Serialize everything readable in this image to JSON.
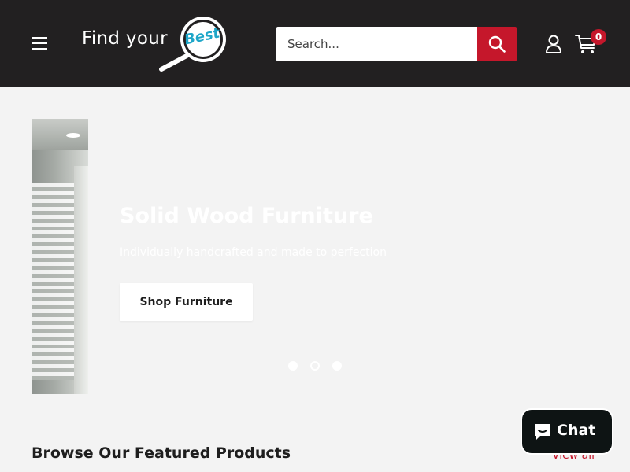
{
  "header": {
    "logo": {
      "text": "Find your",
      "highlight": "Best"
    },
    "search": {
      "placeholder": "Search..."
    },
    "cart": {
      "count": "0"
    },
    "icons": {
      "menu": "hamburger-menu-icon",
      "search": "search-icon",
      "account": "user-icon",
      "cart": "cart-icon"
    }
  },
  "hero": {
    "title": "Solid Wood Furniture",
    "subtitle": "Individually handcrafted and made to perfection",
    "cta_label": "Shop Furniture",
    "slides": 3,
    "active_slide": 1
  },
  "featured": {
    "title": "Browse Our Featured Products",
    "view_all": "View all"
  },
  "chat": {
    "label": "Chat",
    "icon": "chat-bubble-icon"
  },
  "colors": {
    "header_bg": "#222021",
    "accent": "#c5172b",
    "page_bg": "#f3f3f3",
    "chat_bg": "#0e1414",
    "logo_accent": "#1ea6c8"
  }
}
